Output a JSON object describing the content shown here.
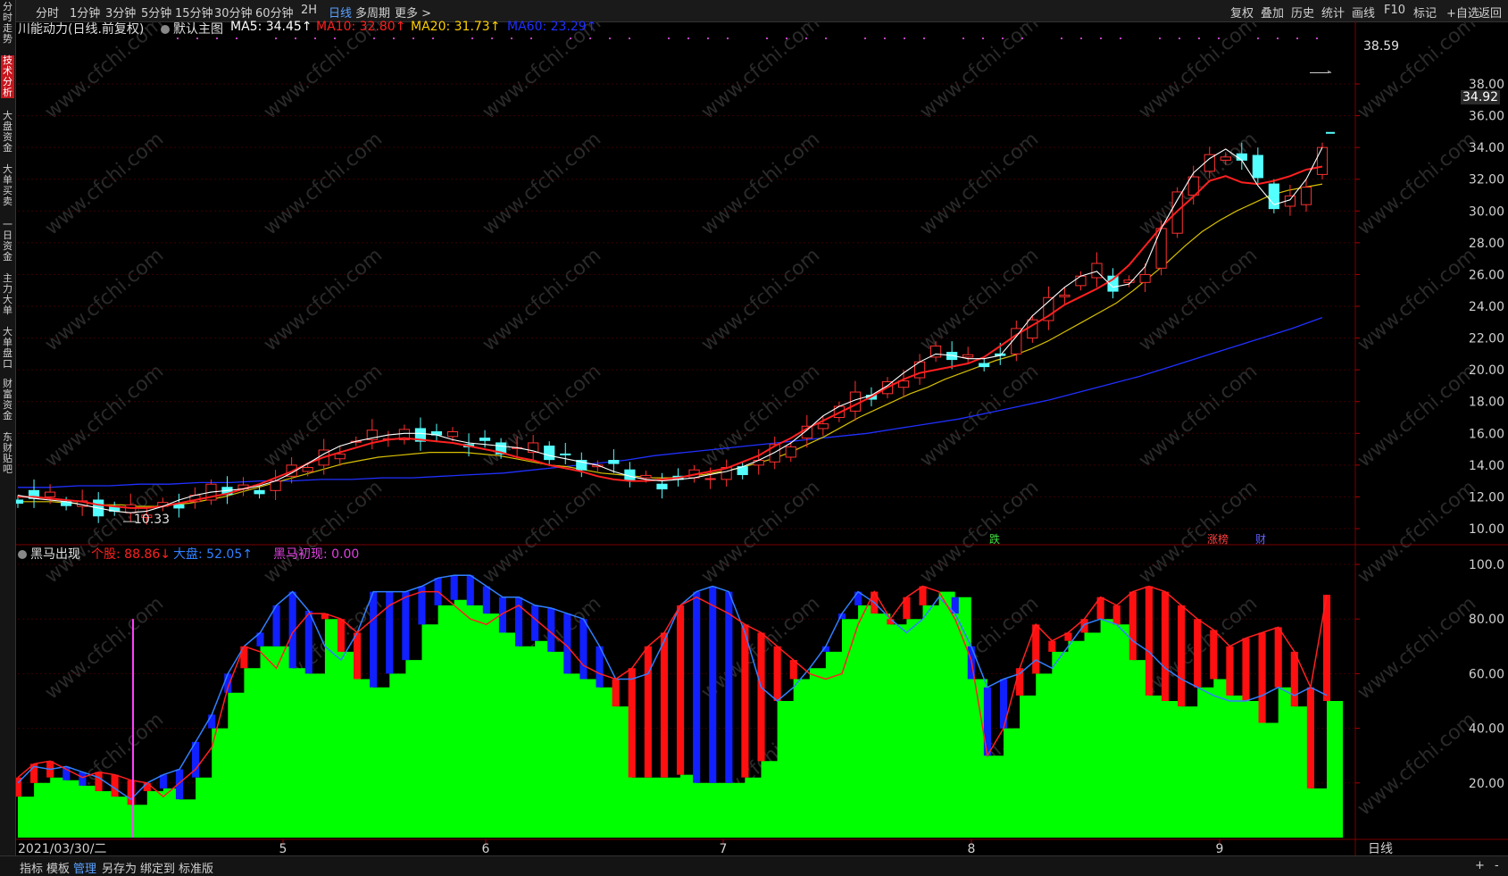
{
  "toolbar": {
    "left": [
      "分时",
      "1分钟",
      "3分钟",
      "5分钟",
      "15分钟",
      "30分钟",
      "60分钟",
      "2H",
      "日线",
      "多周期",
      "更多 >"
    ],
    "active": "日线",
    "right": [
      "复权",
      "叠加",
      "历史",
      "统计",
      "画线",
      "F10",
      "标记",
      "+自选",
      "返回"
    ]
  },
  "sidebar": [
    "分时走势",
    "技术分析",
    "大盘资金",
    "大单买卖",
    "一日资金",
    "主力大单",
    "大单盘口",
    "财富资金",
    "东财贴吧"
  ],
  "sidebar_active": "技术分析",
  "main_legend": {
    "title": "川能动力(日线.前复权)",
    "template": "默认主图",
    "ma5": "MA5: 34.45↑",
    "ma10": "MA10: 32.80↑",
    "ma20": "MA20: 31.73↑",
    "ma60": "MA60: 23.29↑",
    "colors": {
      "ma5": "#ffffff",
      "ma10": "#ff2020",
      "ma20": "#ffd000",
      "ma60": "#2030ff"
    }
  },
  "price_axis": {
    "ticks": [
      "38.00",
      "36.00",
      "34.00",
      "32.00",
      "30.00",
      "28.00",
      "26.00",
      "24.00",
      "22.00",
      "20.00",
      "18.00",
      "16.00",
      "14.00",
      "12.00",
      "10.00"
    ],
    "high_label": "38.59",
    "low_label": "10.33",
    "current_price": "34.92"
  },
  "event_markers": [
    "跌",
    "涨榜",
    "财"
  ],
  "indicator_legend": {
    "name": "黑马出现",
    "stock": "个股: 88.86↓",
    "market": "大盘: 52.05↑",
    "signal": "黑马初现: 0.00",
    "colors": {
      "stock": "#ff2020",
      "market": "#3080ff",
      "signal": "#e040e0"
    }
  },
  "indicator_axis": {
    "ticks": [
      "100.0",
      "80.00",
      "60.00",
      "40.00",
      "20.00"
    ]
  },
  "date_axis": {
    "start": "2021/03/30/二",
    "months": [
      "5",
      "6",
      "7",
      "8",
      "9"
    ],
    "period": "日线"
  },
  "bottom_bar": [
    "指标",
    "模板",
    "管理",
    "另存为",
    "绑定到",
    "标准版"
  ],
  "bottom_active": "管理",
  "watermark": "www.cfchi.com",
  "chart_data": [
    {
      "type": "candlestick",
      "title": "川能动力(日线.前复权)",
      "ylim": [
        10,
        38.6
      ],
      "series": [
        {
          "name": "MA5",
          "values": [
            12.1,
            11.9,
            11.8,
            11.7,
            11.5,
            11.3,
            11.1,
            11.0,
            11.1,
            11.4,
            11.8,
            12.1,
            12.3,
            12.4,
            12.5,
            12.7,
            13.0,
            13.5,
            14.1,
            14.7,
            15.2,
            15.5,
            15.7,
            15.9,
            16.0,
            16.0,
            15.9,
            15.6,
            15.4,
            15.3,
            15.2,
            15.1,
            14.9,
            14.6,
            14.4,
            14.2,
            14.0,
            13.6,
            13.3,
            13.1,
            13.0,
            13.1,
            13.2,
            13.4,
            13.6,
            13.9,
            14.3,
            14.8,
            15.4,
            16.2,
            17.1,
            17.7,
            18.1,
            18.4,
            19.0,
            19.8,
            20.5,
            21.0,
            20.9,
            20.7,
            20.7,
            20.9,
            22.1,
            23.4,
            24.3,
            25.2,
            25.9,
            26.2,
            25.2,
            25.4,
            26.5,
            28.9,
            30.7,
            32.4,
            33.3,
            33.9,
            33.2,
            31.6,
            30.4,
            30.7,
            32.0,
            34.0
          ]
        },
        {
          "name": "MA10",
          "values": [
            12.0,
            12.0,
            11.9,
            11.8,
            11.7,
            11.5,
            11.4,
            11.3,
            11.3,
            11.4,
            11.6,
            11.8,
            12.0,
            12.2,
            12.5,
            12.8,
            13.2,
            13.6,
            14.1,
            14.5,
            14.8,
            15.1,
            15.4,
            15.6,
            15.7,
            15.6,
            15.5,
            15.4,
            15.2,
            15.0,
            14.8,
            14.5,
            14.3,
            14.0,
            13.8,
            13.6,
            13.3,
            13.1,
            13.0,
            13.0,
            13.1,
            13.2,
            13.4,
            13.6,
            13.8,
            14.2,
            14.6,
            15.2,
            15.7,
            16.3,
            16.8,
            17.3,
            17.8,
            18.3,
            18.9,
            19.4,
            19.8,
            20.0,
            20.2,
            20.4,
            20.8,
            21.5,
            22.2,
            22.8,
            23.4,
            24.1,
            24.6,
            25.1,
            25.7,
            26.6,
            27.8,
            29.0,
            30.0,
            30.9,
            31.9,
            32.2,
            31.8,
            31.7,
            31.9,
            32.2,
            32.6,
            32.8
          ]
        },
        {
          "name": "MA20",
          "values": [
            11.7,
            11.7,
            11.7,
            11.6,
            11.6,
            11.5,
            11.5,
            11.4,
            11.4,
            11.5,
            11.6,
            11.8,
            12.0,
            12.3,
            12.6,
            12.9,
            13.2,
            13.5,
            13.8,
            14.1,
            14.3,
            14.5,
            14.6,
            14.7,
            14.8,
            14.8,
            14.8,
            14.7,
            14.6,
            14.4,
            14.2,
            14.0,
            13.9,
            13.7,
            13.5,
            13.4,
            13.3,
            13.2,
            13.2,
            13.3,
            13.4,
            13.6,
            13.8,
            14.1,
            14.4,
            14.8,
            15.3,
            15.8,
            16.4,
            17.0,
            17.5,
            18.0,
            18.5,
            18.9,
            19.4,
            19.8,
            20.2,
            20.6,
            20.9,
            21.3,
            21.8,
            22.4,
            23.0,
            23.6,
            24.2,
            25.0,
            25.9,
            26.8,
            27.8,
            28.7,
            29.4,
            30.0,
            30.5,
            31.0,
            31.3,
            31.5,
            31.7
          ]
        },
        {
          "name": "MA60",
          "values": [
            12.6,
            12.6,
            12.7,
            12.7,
            12.8,
            12.8,
            12.9,
            12.9,
            13.0,
            13.0,
            13.1,
            13.1,
            13.2,
            13.2,
            13.3,
            13.4,
            13.5,
            13.7,
            13.9,
            14.1,
            14.3,
            14.6,
            14.8,
            15.0,
            15.2,
            15.4,
            15.6,
            15.8,
            16.0,
            16.3,
            16.6,
            16.9,
            17.3,
            17.7,
            18.1,
            18.6,
            19.1,
            19.6,
            20.2,
            20.8,
            21.4,
            22.0,
            22.6,
            23.29
          ]
        }
      ]
    },
    {
      "type": "area",
      "title": "黑马出现",
      "ylim": [
        0,
        100
      ],
      "series": [
        {
          "name": "个股",
          "values": [
            22,
            27,
            28,
            25,
            22,
            24,
            23,
            21,
            20,
            15,
            20,
            25,
            33,
            55,
            70,
            68,
            62,
            75,
            82,
            82,
            80,
            75,
            80,
            85,
            88,
            90,
            90,
            85,
            80,
            78,
            82,
            85,
            80,
            75,
            70,
            63,
            60,
            58,
            62,
            70,
            75,
            85,
            88,
            85,
            82,
            78,
            75,
            70,
            65,
            60,
            58,
            60,
            78,
            90,
            80,
            88,
            92,
            90,
            80,
            65,
            30,
            40,
            62,
            78,
            72,
            75,
            80,
            88,
            85,
            90,
            92,
            90,
            85,
            80,
            76,
            70,
            73,
            75,
            77,
            68,
            55,
            88.86
          ]
        },
        {
          "name": "大盘",
          "values": [
            20,
            26,
            25,
            26,
            24,
            22,
            18,
            14,
            20,
            23,
            25,
            35,
            45,
            60,
            70,
            75,
            85,
            90,
            83,
            70,
            65,
            75,
            90,
            90,
            90,
            92,
            95,
            96,
            96,
            92,
            88,
            88,
            85,
            84,
            82,
            80,
            70,
            58,
            58,
            60,
            72,
            85,
            90,
            92,
            90,
            75,
            55,
            50,
            55,
            62,
            70,
            82,
            90,
            86,
            80,
            75,
            80,
            88,
            82,
            70,
            55,
            58,
            60,
            65,
            62,
            70,
            78,
            80,
            78,
            72,
            68,
            62,
            58,
            55,
            52,
            50,
            50,
            52,
            55,
            52,
            55,
            52.05
          ]
        },
        {
          "name": "基线",
          "values": [
            15,
            20,
            22,
            21,
            19,
            17,
            15,
            12,
            17,
            18,
            14,
            22,
            40,
            53,
            62,
            70,
            70,
            62,
            60,
            80,
            68,
            58,
            55,
            60,
            65,
            78,
            85,
            87,
            85,
            82,
            75,
            70,
            72,
            68,
            60,
            58,
            55,
            48,
            22,
            22,
            22,
            23,
            20,
            20,
            20,
            22,
            28,
            50,
            58,
            62,
            68,
            80,
            85,
            82,
            78,
            80,
            85,
            90,
            88,
            58,
            30,
            40,
            52,
            60,
            68,
            72,
            75,
            80,
            78,
            65,
            52,
            50,
            48,
            55,
            58,
            52,
            50,
            42,
            55,
            48,
            18,
            50
          ]
        }
      ]
    }
  ]
}
